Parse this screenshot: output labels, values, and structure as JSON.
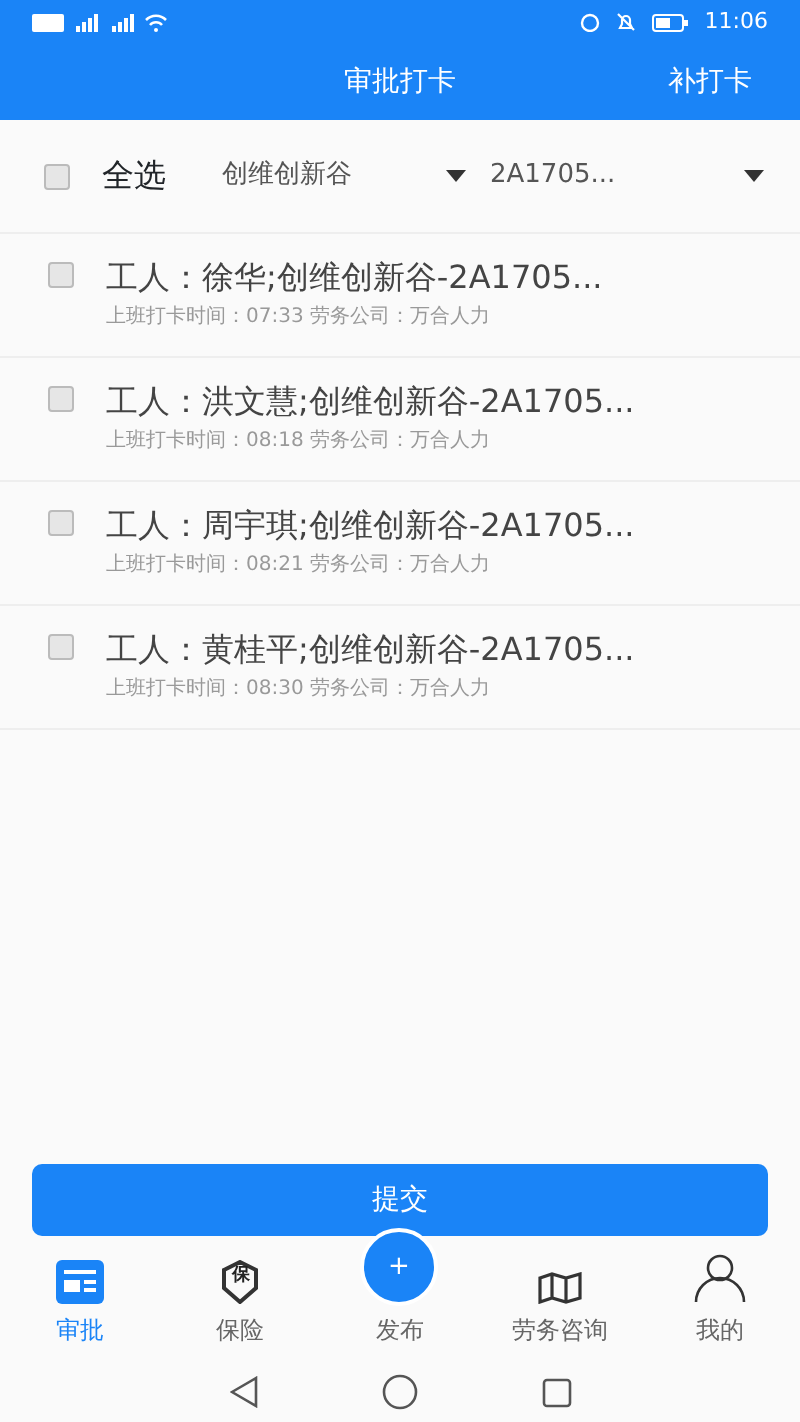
{
  "status_bar": {
    "time": "11:06"
  },
  "header": {
    "title": "审批打卡",
    "action": "补打卡"
  },
  "filter": {
    "select_all": {
      "label": "全选",
      "checked": false
    },
    "site": "创维创新谷",
    "unit": "2A1705..."
  },
  "records": [
    {
      "title": "工人：徐华;创维创新谷-2A1705...",
      "detail": "上班打卡时间：07:33 劳务公司：万合人力",
      "checked": false
    },
    {
      "title": "工人：洪文慧;创维创新谷-2A1705...",
      "detail": "上班打卡时间：08:18 劳务公司：万合人力",
      "checked": false
    },
    {
      "title": "工人：周宇琪;创维创新谷-2A1705...",
      "detail": "上班打卡时间：08:21 劳务公司：万合人力",
      "checked": false
    },
    {
      "title": "工人：黄桂平;创维创新谷-2A1705...",
      "detail": "上班打卡时间：08:30 劳务公司：万合人力",
      "checked": false
    }
  ],
  "submit_button": "提交",
  "tab_bar": [
    {
      "kind": "card",
      "label": "审批",
      "selected": true
    },
    {
      "kind": "shield",
      "label": "保险",
      "selected": false,
      "glyph": "保"
    },
    {
      "kind": "plus",
      "label": "发布",
      "selected": false,
      "glyph": "+"
    },
    {
      "kind": "map",
      "label": "劳务咨询",
      "selected": false
    },
    {
      "kind": "person",
      "label": "我的",
      "selected": false
    }
  ]
}
